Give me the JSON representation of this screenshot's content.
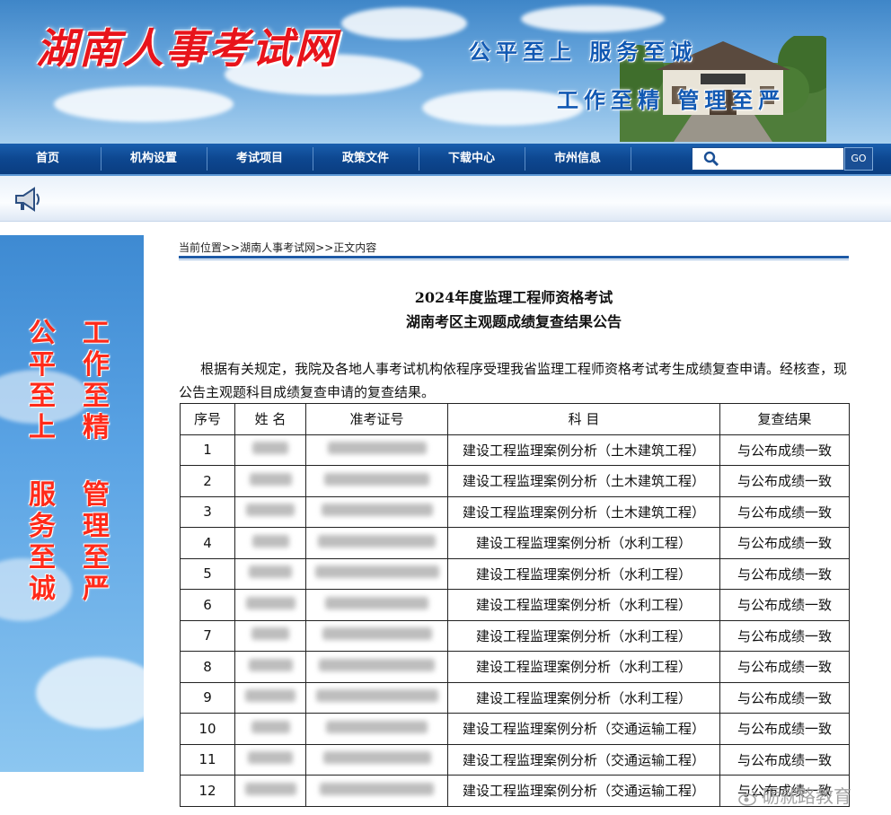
{
  "header": {
    "site_name": "湖南人事考试网",
    "slogan_line1": "公平至上  服务至诚",
    "slogan_line2": "工作至精  管理至严"
  },
  "nav": {
    "items": [
      "首页",
      "机构设置",
      "考试项目",
      "政策文件",
      "下载中心",
      "市州信息"
    ],
    "search_placeholder": "",
    "go_label": "GO"
  },
  "sidebar": {
    "columns": [
      "公平至上",
      "服务至诚",
      "工作至精",
      "管理至严"
    ]
  },
  "breadcrumb": {
    "prefix": "当前位置>>",
    "home": "湖南人事考试网",
    "sep": ">>",
    "current": "正文内容"
  },
  "article": {
    "title_line1": "2024年度监理工程师资格考试",
    "title_line2": "湖南考区主观题成绩复查结果公告",
    "paragraph": "根据有关规定，我院及各地人事考试机构依程序受理我省监理工程师资格考试考生成绩复查申请。经核查，现公告主观题科目成绩复查申请的复查结果。"
  },
  "table": {
    "headers": [
      "序号",
      "姓 名",
      "准考证号",
      "科 目",
      "复查结果"
    ],
    "rows": [
      {
        "no": "1",
        "subject": "建设工程监理案例分析（土木建筑工程）",
        "result": "与公布成绩一致"
      },
      {
        "no": "2",
        "subject": "建设工程监理案例分析（土木建筑工程）",
        "result": "与公布成绩一致"
      },
      {
        "no": "3",
        "subject": "建设工程监理案例分析（土木建筑工程）",
        "result": "与公布成绩一致"
      },
      {
        "no": "4",
        "subject": "建设工程监理案例分析（水利工程）",
        "result": "与公布成绩一致"
      },
      {
        "no": "5",
        "subject": "建设工程监理案例分析（水利工程）",
        "result": "与公布成绩一致"
      },
      {
        "no": "6",
        "subject": "建设工程监理案例分析（水利工程）",
        "result": "与公布成绩一致"
      },
      {
        "no": "7",
        "subject": "建设工程监理案例分析（水利工程）",
        "result": "与公布成绩一致"
      },
      {
        "no": "8",
        "subject": "建设工程监理案例分析（水利工程）",
        "result": "与公布成绩一致"
      },
      {
        "no": "9",
        "subject": "建设工程监理案例分析（水利工程）",
        "result": "与公布成绩一致"
      },
      {
        "no": "10",
        "subject": "建设工程监理案例分析（交通运输工程）",
        "result": "与公布成绩一致"
      },
      {
        "no": "11",
        "subject": "建设工程监理案例分析（交通运输工程）",
        "result": "与公布成绩一致"
      },
      {
        "no": "12",
        "subject": "建设工程监理案例分析（交通运输工程）",
        "result": "与公布成绩一致"
      }
    ]
  },
  "watermark": {
    "text": "砺就路教育"
  },
  "colors": {
    "nav_blue": "#0d4790",
    "logo_red": "#e8141b",
    "slogan_blue": "#1259b3",
    "side_text_red": "#ff2a1a"
  }
}
